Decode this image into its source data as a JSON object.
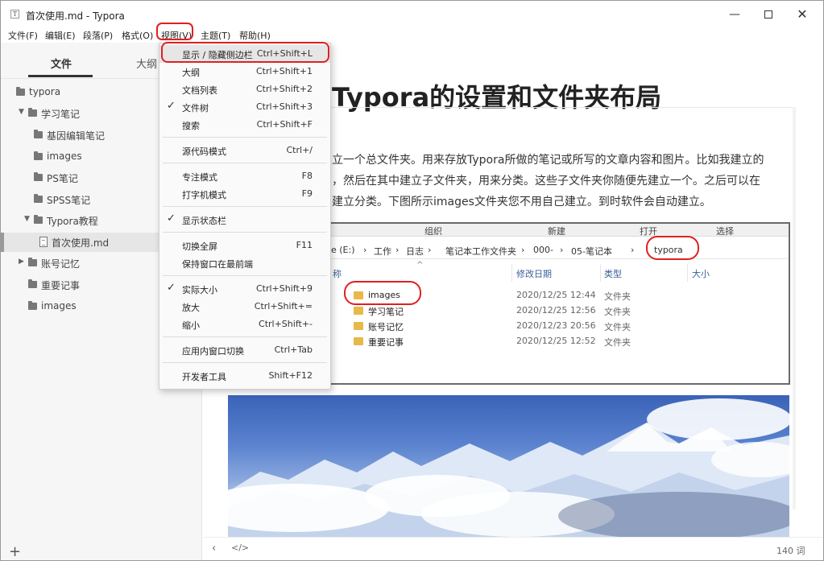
{
  "window": {
    "title": "首次使用.md - Typora",
    "app_icon": "T"
  },
  "menubar": {
    "items": [
      "文件(F)",
      "编辑(E)",
      "段落(P)",
      "格式(O)",
      "视图(V)",
      "主题(T)",
      "帮助(H)"
    ]
  },
  "sidebar": {
    "tab_files": "文件",
    "tab_outline": "大纲",
    "tree": [
      {
        "label": "typora",
        "type": "folder",
        "level": 0
      },
      {
        "label": "学习笔记",
        "type": "folder",
        "level": 1,
        "expanded": true
      },
      {
        "label": "基因编辑笔记",
        "type": "folder",
        "level": 2
      },
      {
        "label": "images",
        "type": "folder",
        "level": 2
      },
      {
        "label": "PS笔记",
        "type": "folder",
        "level": 2
      },
      {
        "label": "SPSS笔记",
        "type": "folder",
        "level": 2
      },
      {
        "label": "Typora教程",
        "type": "folder",
        "level": 2,
        "expanded": true
      },
      {
        "label": "首次使用.md",
        "type": "file",
        "level": 3,
        "active": true
      },
      {
        "label": "账号记忆",
        "type": "folder",
        "level": 1,
        "collapsed": true
      },
      {
        "label": "重要记事",
        "type": "folder",
        "level": 1
      },
      {
        "label": "images",
        "type": "folder",
        "level": 1
      }
    ],
    "add_label": "+"
  },
  "view_menu": {
    "items": [
      {
        "label": "显示 / 隐藏侧边栏",
        "shortcut": "Ctrl+Shift+L",
        "checked": false
      },
      {
        "label": "大纲",
        "shortcut": "Ctrl+Shift+1",
        "checked": false
      },
      {
        "label": "文档列表",
        "shortcut": "Ctrl+Shift+2",
        "checked": false
      },
      {
        "label": "文件树",
        "shortcut": "Ctrl+Shift+3",
        "checked": true
      },
      {
        "label": "搜索",
        "shortcut": "Ctrl+Shift+F",
        "checked": false
      },
      {
        "label": "源代码模式",
        "shortcut": "Ctrl+/",
        "checked": false
      },
      {
        "label": "专注模式",
        "shortcut": "F8",
        "checked": false
      },
      {
        "label": "打字机模式",
        "shortcut": "F9",
        "checked": false
      },
      {
        "label": "显示状态栏",
        "shortcut": "",
        "checked": true
      },
      {
        "label": "切换全屏",
        "shortcut": "F11",
        "checked": false
      },
      {
        "label": "保持窗口在最前端",
        "shortcut": "",
        "checked": false
      },
      {
        "label": "实际大小",
        "shortcut": "Ctrl+Shift+9",
        "checked": true
      },
      {
        "label": "放大",
        "shortcut": "Ctrl+Shift+=",
        "checked": false
      },
      {
        "label": "缩小",
        "shortcut": "Ctrl+Shift+-",
        "checked": false
      },
      {
        "label": "应用内窗口切换",
        "shortcut": "Ctrl+Tab",
        "checked": false
      },
      {
        "label": "开发者工具",
        "shortcut": "Shift+F12",
        "checked": false
      }
    ],
    "check_glyph": "✓"
  },
  "editor": {
    "heading": "Typora的设置和文件夹布局",
    "paragraph_lines": [
      "立一个总文件夹。用来存放Typora所做的笔记或所写的文章内容和图片。比如我建立的",
      "，然后在其中建立子文件夹，用来分类。这些子文件夹你随便先建立一个。之后可以在",
      "建立分类。下图所示images文件夹您不用自己建立。到时软件会自动建立。"
    ],
    "word_count": "140 词"
  },
  "explorer": {
    "ribbon": [
      "组织",
      "新建",
      "打开",
      "选择"
    ],
    "address": [
      "e (E:)",
      "›",
      "工作",
      "›",
      "日志",
      "›",
      "笔记本工作文件夹",
      "›",
      "000-",
      "›",
      "05-笔记本",
      "›",
      "typora"
    ],
    "columns": [
      "称",
      "修改日期",
      "类型",
      "大小"
    ],
    "rows": [
      {
        "name": "images",
        "date": "2020/12/25 12:44",
        "type": "文件夹"
      },
      {
        "name": "学习笔记",
        "date": "2020/12/25 12:56",
        "type": "文件夹"
      },
      {
        "name": "账号记忆",
        "date": "2020/12/23 20:56",
        "type": "文件夹"
      },
      {
        "name": "重要记事",
        "date": "2020/12/25 12:52",
        "type": "文件夹"
      }
    ]
  },
  "colors": {
    "accent_red": "#e02020",
    "sidebar_bg": "#f6f6f6",
    "folder_yellow": "#e8b94a"
  }
}
